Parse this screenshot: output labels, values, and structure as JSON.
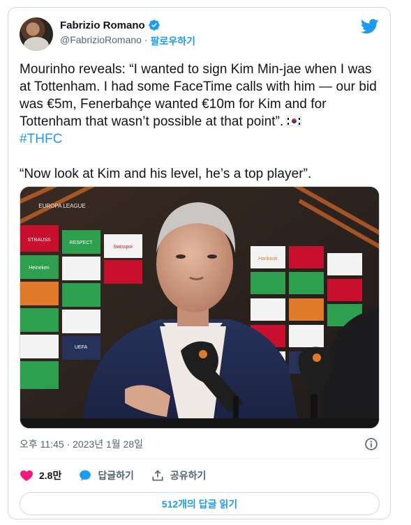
{
  "author": {
    "name": "Fabrizio Romano",
    "handle": "@FabrizioRomano",
    "separator": "·",
    "follow_label": "팔로우하기"
  },
  "tweet": {
    "line1": "Mourinho reveals: “I wanted to sign Kim Min-jae when I was at Tottenham. I had some FaceTime calls with him — our bid was €5m, Fenerbahçe wanted €10m for Kim and for Tottenham that wasn’t possible at that point”.",
    "hashtag": "#THFC",
    "line2": "“Now look at Kim and his level, he’s a top player”."
  },
  "media": {
    "backdrop_labels": [
      "STRAUSS",
      "RESPECT",
      "Swisspoi",
      "Heineken",
      "UEFA",
      "EUROPA LEAGUE",
      "Hankook"
    ]
  },
  "timestamp": "오후 11:45 · 2023년 1월 28일",
  "actions": {
    "like_count": "2.8만",
    "reply_label": "답글하기",
    "share_label": "공유하기"
  },
  "replies_button": "512개의 답글 읽기",
  "colors": {
    "accent": "#1d9bf0",
    "like": "#f91880",
    "muted": "#536471"
  }
}
